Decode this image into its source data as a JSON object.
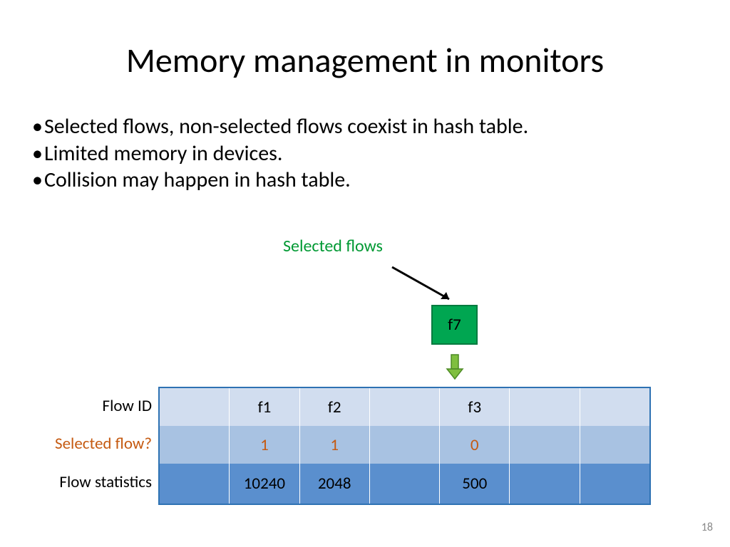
{
  "title": "Memory management in monitors",
  "bullets": [
    "Selected flows, non-selected flows coexist in hash table.",
    "Limited memory in devices.",
    "Collision may happen in hash table."
  ],
  "annotation": {
    "selected_flows_label": "Selected flows",
    "incoming_flow": "f7"
  },
  "row_labels": {
    "flow_id": "Flow ID",
    "selected_flow": "Selected flow?",
    "flow_statistics": "Flow statistics"
  },
  "table": {
    "flow_id": [
      "",
      "f1",
      "f2",
      "",
      "f3",
      "",
      ""
    ],
    "selected_flow": [
      "",
      "1",
      "1",
      "",
      "0",
      "",
      ""
    ],
    "flow_statistics": [
      "",
      "10240",
      "2048",
      "",
      "500",
      "",
      ""
    ]
  },
  "page_number": "18"
}
